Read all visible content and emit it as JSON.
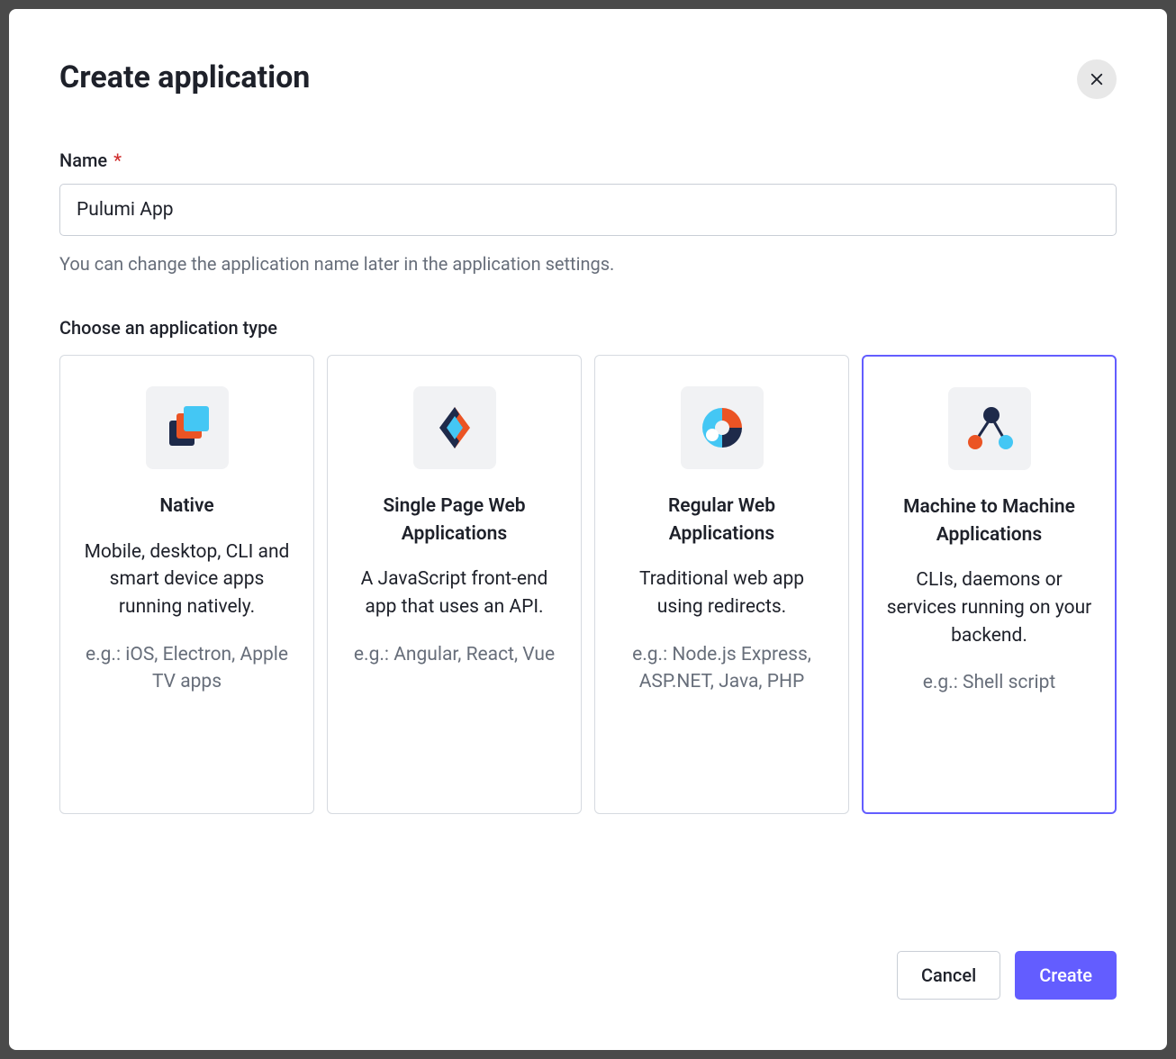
{
  "modal": {
    "title": "Create application",
    "nameField": {
      "label": "Name",
      "required": "*",
      "value": "Pulumi App",
      "hint": "You can change the application name later in the application settings."
    },
    "typeSection": {
      "label": "Choose an application type",
      "options": [
        {
          "title": "Native",
          "description": "Mobile, desktop, CLI and smart device apps running natively.",
          "example": "e.g.: iOS, Electron, Apple TV apps",
          "selected": false
        },
        {
          "title": "Single Page Web Applications",
          "description": "A JavaScript front-end app that uses an API.",
          "example": "e.g.: Angular, React, Vue",
          "selected": false
        },
        {
          "title": "Regular Web Applications",
          "description": "Traditional web app using redirects.",
          "example": "e.g.: Node.js Express, ASP.NET, Java, PHP",
          "selected": false
        },
        {
          "title": "Machine to Machine Applications",
          "description": "CLIs, daemons or services running on your backend.",
          "example": "e.g.: Shell script",
          "selected": true
        }
      ]
    },
    "footer": {
      "cancel": "Cancel",
      "create": "Create"
    }
  },
  "colors": {
    "accent": "#635dff",
    "orange": "#eb5424",
    "navy": "#1e2a4a",
    "blue": "#44c7f4"
  }
}
